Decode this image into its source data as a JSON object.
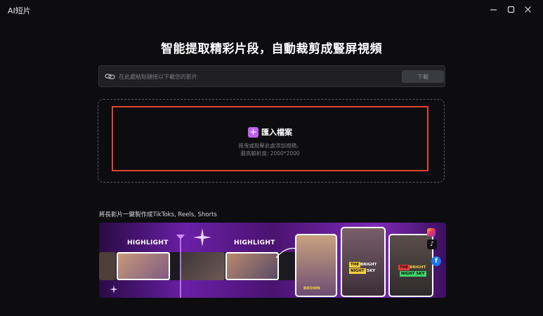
{
  "window": {
    "title": "AI短片"
  },
  "headline": "智能提取精彩片段，自動裁剪成豎屏視頻",
  "url_bar": {
    "placeholder": "在此處粘貼鏈接以下載您的影片",
    "download_label": "下載"
  },
  "import": {
    "label": "匯入檔案",
    "hint_line1": "拖曳或點擊此處添加視頻。",
    "hint_line2": "最高解析度: 2000*2000"
  },
  "promo": {
    "caption": "將長影片一鍵製作成TikToks, Reels, Shorts",
    "highlight_1": "HIGHLIGHT",
    "highlight_2": "HIGHLIGHT",
    "card_tag_brown": "BROWN",
    "card_tag_the": "THE",
    "card_tag_bright": "BRIGHT",
    "card_tag_night": "NIGHT",
    "card_tag_sky": "SKY",
    "card2_tag_the": "THE",
    "card2_tag_bright": "BRIGHT",
    "card2_tag_night": "NIGHT SKY",
    "social_icons": [
      "instagram-icon",
      "tiktok-icon",
      "facebook-icon"
    ]
  },
  "colors": {
    "accent": "#c060ef",
    "highlight_border": "#e0452e",
    "background": "#0d0d10"
  }
}
